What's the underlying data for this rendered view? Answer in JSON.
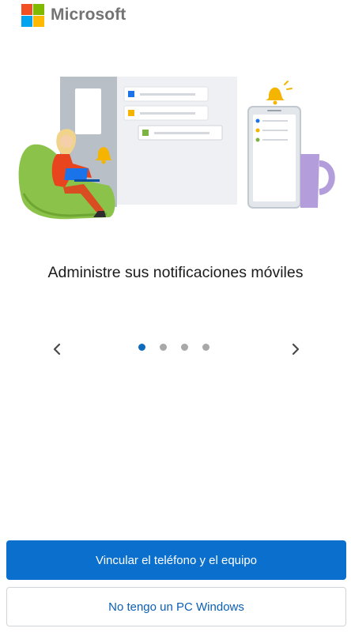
{
  "brand": {
    "name": "Microsoft",
    "logo_colors": [
      "#f25022",
      "#7fba00",
      "#00a4ef",
      "#ffb900"
    ]
  },
  "onboarding": {
    "headline": "Administre sus notificaciones móviles",
    "illustration": "woman-on-couch-with-laptop-and-phone-notifications",
    "prev_icon": "chevron-left-icon",
    "next_icon": "chevron-right-icon",
    "page_count": 4,
    "current_page": 1
  },
  "actions": {
    "primary_label": "Vincular el teléfono y el equipo",
    "secondary_label": "No tengo un PC Windows"
  },
  "colors": {
    "accent": "#0b6fce",
    "dot_active": "#0f6cbd",
    "dot_inactive": "#a8a8a8"
  }
}
